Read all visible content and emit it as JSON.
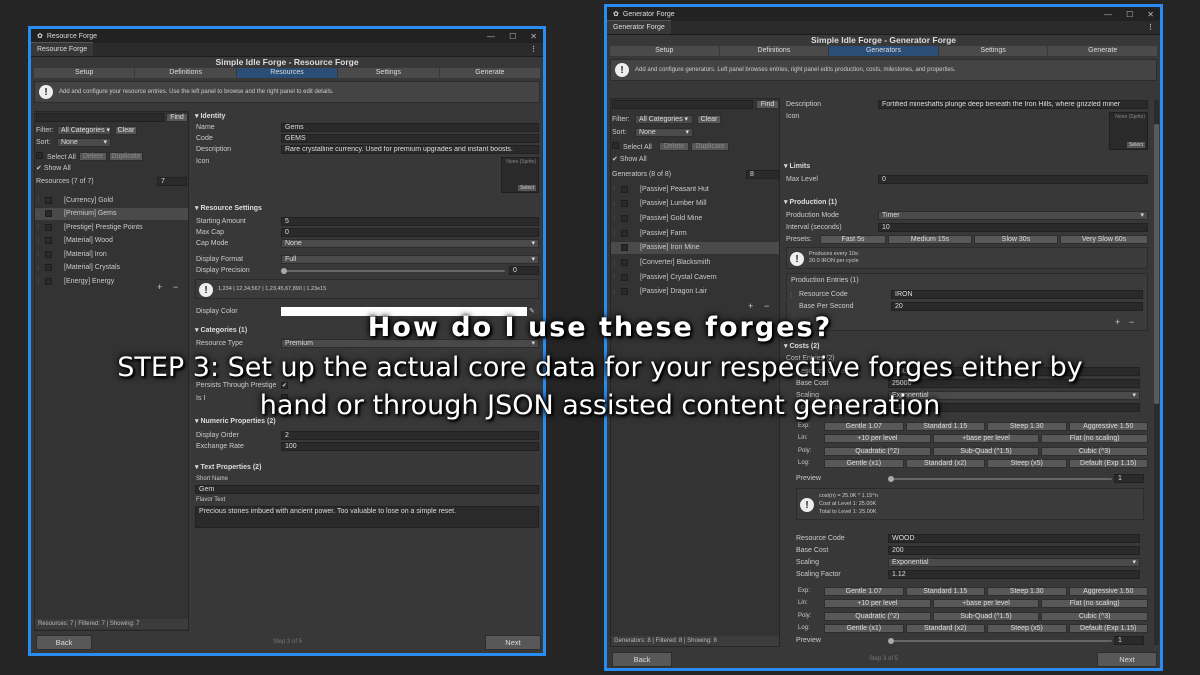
{
  "left_window": {
    "title": "Resource Forge",
    "tab": "Resource Forge",
    "app_title": "Simple Idle Forge - Resource Forge",
    "nav": [
      "Setup",
      "Definitions",
      "Resources",
      "Settings",
      "Generate"
    ],
    "active_nav": "Resources",
    "info": "Add and configure your resource entries. Use the left panel to browse and the right panel to edit details.",
    "left_panel": {
      "search_placeholder": "",
      "find": "Find",
      "filter_label": "Filter:",
      "filter_value": "All Categories",
      "clear": "Clear",
      "sort_label": "Sort:",
      "sort_value": "None",
      "select_all": "Select All",
      "delete": "Delete",
      "duplicate": "Duplicate",
      "show_all": "Show All",
      "count_label": "Resources (7 of 7)",
      "count_value": "7",
      "items": [
        "[Currency] Gold",
        "[Premium] Gems",
        "[Prestige] Prestige Points",
        "[Material] Wood",
        "[Material] Iron",
        "[Material] Crystals",
        "[Energy] Energy"
      ],
      "add": "+",
      "remove": "−",
      "footer": "Resources: 7 | Filtered: 7 | Showing: 7"
    },
    "identity": {
      "header": "Identity",
      "name_label": "Name",
      "name_value": "Gems",
      "code_label": "Code",
      "code_value": "GEMS",
      "desc_label": "Description",
      "desc_value": "Rare crystalline currency. Used for premium upgrades and instant boosts.",
      "icon_label": "Icon",
      "icon_none": "None (Sprite)",
      "icon_select": "Select"
    },
    "resource_settings": {
      "header": "Resource Settings",
      "starting_label": "Starting Amount",
      "starting_value": "5",
      "maxcap_label": "Max Cap",
      "maxcap_value": "0",
      "capmode_label": "Cap Mode",
      "capmode_value": "None",
      "format_label": "Display Format",
      "format_value": "Full",
      "precision_label": "Display Precision",
      "precision_value": "0",
      "format_hint": "1,234  |  12,34,567  |  1,23,45,67,890  |  1.23e15",
      "color_label": "Display Color"
    },
    "categories": {
      "header": "Categories (1)",
      "type_label": "Resource Type",
      "type_value": "Premium",
      "persists_label": "Persists Through Prestige",
      "is_label": "Is I"
    },
    "numeric": {
      "header": "Numeric Properties (2)",
      "order_label": "Display Order",
      "order_value": "2",
      "rate_label": "Exchange Rate",
      "rate_value": "100"
    },
    "text_props": {
      "header": "Text Properties (2)",
      "short_label": "Short Name",
      "short_value": "Gem",
      "flavor_label": "Flavor Text",
      "flavor_value": "Precious stones imbued with ancient power. Too valuable to lose on a simple reset."
    },
    "back": "Back",
    "next": "Next",
    "step": "Step 3 of 5"
  },
  "right_window": {
    "title": "Generator Forge",
    "tab": "Generator Forge",
    "app_title": "Simple Idle Forge - Generator Forge",
    "nav": [
      "Setup",
      "Definitions",
      "Generators",
      "Settings",
      "Generate"
    ],
    "active_nav": "Generators",
    "info": "Add and configure generators. Left panel browses entries, right panel edits production, costs, milestones, and properties.",
    "left_panel": {
      "find": "Find",
      "filter_label": "Filter:",
      "filter_value": "All Categories",
      "clear": "Clear",
      "sort_label": "Sort:",
      "sort_value": "None",
      "select_all": "Select All",
      "delete": "Delete",
      "duplicate": "Duplicate",
      "show_all": "Show All",
      "count_label": "Generators (8 of 8)",
      "count_value": "8",
      "items": [
        "[Passive] Peasant Hut",
        "[Passive] Lumber Mill",
        "[Passive] Gold Mine",
        "[Passive] Farm",
        "[Passive] Iron Mine",
        "[Converter] Blacksmith",
        "[Passive] Crystal Cavern",
        "[Passive] Dragon Lair"
      ],
      "add": "+",
      "remove": "−",
      "footer": "Generators: 8 | Filtered: 8 | Showing: 8"
    },
    "top": {
      "desc_label": "Description",
      "desc_value": "Fortified mineshafts plunge deep beneath the Iron Hills, where grizzled miner",
      "icon_label": "Icon",
      "icon_none": "None (Sprite)",
      "icon_select": "Select"
    },
    "limits": {
      "header": "Limits",
      "max_label": "Max Level",
      "max_value": "0"
    },
    "production": {
      "header": "Production (1)",
      "mode_label": "Production Mode",
      "mode_value": "Timer",
      "interval_label": "Interval (seconds)",
      "interval_value": "10",
      "presets_label": "Presets:",
      "presets": [
        "Fast 5s",
        "Medium 15s",
        "Slow 30s",
        "Very Slow 60s"
      ],
      "hint_line1": "Produces every 10s:",
      "hint_line2": "20.0 IRON per cycle",
      "entries_header": "Production Entries (1)",
      "res_label": "Resource Code",
      "res_value": "IRON",
      "base_label": "Base Per Second",
      "base_value": "20"
    },
    "costs": {
      "header": "Costs (2)",
      "entries_header": "Cost Entries (2)",
      "e1_res_label": "Resource Code",
      "e1_res_value": "GOLD",
      "e1_base_label": "Base Cost",
      "e1_base_value": "25000",
      "e1_scaling_label": "Scaling",
      "e1_scaling_value": "Exponential",
      "e1_factor_label": "Scaling Factor",
      "e1_factor_value": "1.15",
      "rows": [
        {
          "label": "Exp:",
          "buttons": [
            "Gentle 1.07",
            "Standard 1.15",
            "Steep 1.30",
            "Aggressive 1.50"
          ]
        },
        {
          "label": "Lin:",
          "buttons": [
            "+10 per level",
            "+base per level",
            "Flat (no scaling)"
          ]
        },
        {
          "label": "Poly:",
          "buttons": [
            "Quadratic (^2)",
            "Sub-Quad (^1.5)",
            "Cubic (^3)"
          ]
        },
        {
          "label": "Log:",
          "buttons": [
            "Gentle (x1)",
            "Standard (x2)",
            "Steep (x5)",
            "Default (Exp 1.15)"
          ]
        }
      ],
      "preview_label": "Preview",
      "preview_value": "1",
      "formula1": "cost(n) = 25.0K * 1.15^n",
      "formula2": "Cost at Level 1: 25.00K",
      "formula3": "Total to Level 1: 25.00K",
      "e2_res_label": "Resource Code",
      "e2_res_value": "WOOD",
      "e2_base_label": "Base Cost",
      "e2_base_value": "200",
      "e2_scaling_label": "Scaling",
      "e2_scaling_value": "Exponential",
      "e2_factor_label": "Scaling Factor",
      "e2_factor_value": "1.12",
      "preview2_value": "1"
    },
    "back": "Back",
    "next": "Next",
    "step": "Step 3 of 5"
  },
  "overlay": {
    "line1": "How do I use these forges?",
    "line2": "STEP 3: Set up the actual core data for your respective forges either by",
    "line3": "hand or through JSON assisted content generation"
  },
  "colors": {
    "accent_border": "#2a8cf0",
    "active_tab": "#2a4e75"
  }
}
